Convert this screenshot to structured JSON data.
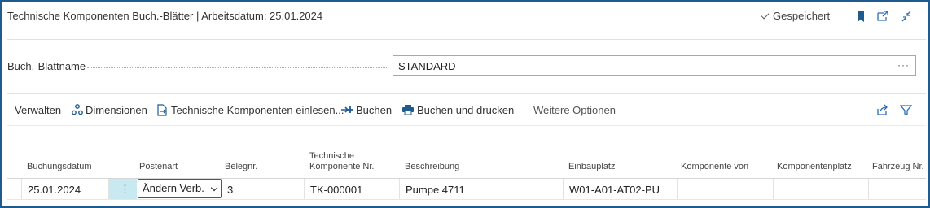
{
  "header": {
    "title": "Technische Komponenten Buch.-Blätter | Arbeitsdatum: 25.01.2024",
    "saved_label": "Gespeichert",
    "accent_color": "#1f5b8e"
  },
  "batch": {
    "label": "Buch.-Blattname",
    "value": "STANDARD",
    "more": "···"
  },
  "toolbar": {
    "manage": "Verwalten",
    "dimensions": "Dimensionen",
    "import_components": "Technische Komponenten einlesen...",
    "post": "Buchen",
    "post_print": "Buchen und drucken",
    "more_options": "Weitere Optionen"
  },
  "columns": {
    "posting_date": "Buchungsdatum",
    "entry_type": "Postenart",
    "doc_no": "Belegnr.",
    "component_no_1": "Technische",
    "component_no_2": "Komponente Nr.",
    "description": "Beschreibung",
    "installation": "Einbauplatz",
    "component_from": "Komponente von",
    "component_place": "Komponentenplatz",
    "vehicle_no": "Fahrzeug Nr."
  },
  "rows": [
    {
      "posting_date": "25.01.2024",
      "menu": "⋮",
      "entry_type": "Ändern Verb.",
      "doc_no": "3",
      "component_no": "TK-000001",
      "description": "Pumpe 4711",
      "installation": "W01-A01-AT02-PU",
      "component_from": "",
      "component_place": "",
      "vehicle_no": ""
    }
  ]
}
